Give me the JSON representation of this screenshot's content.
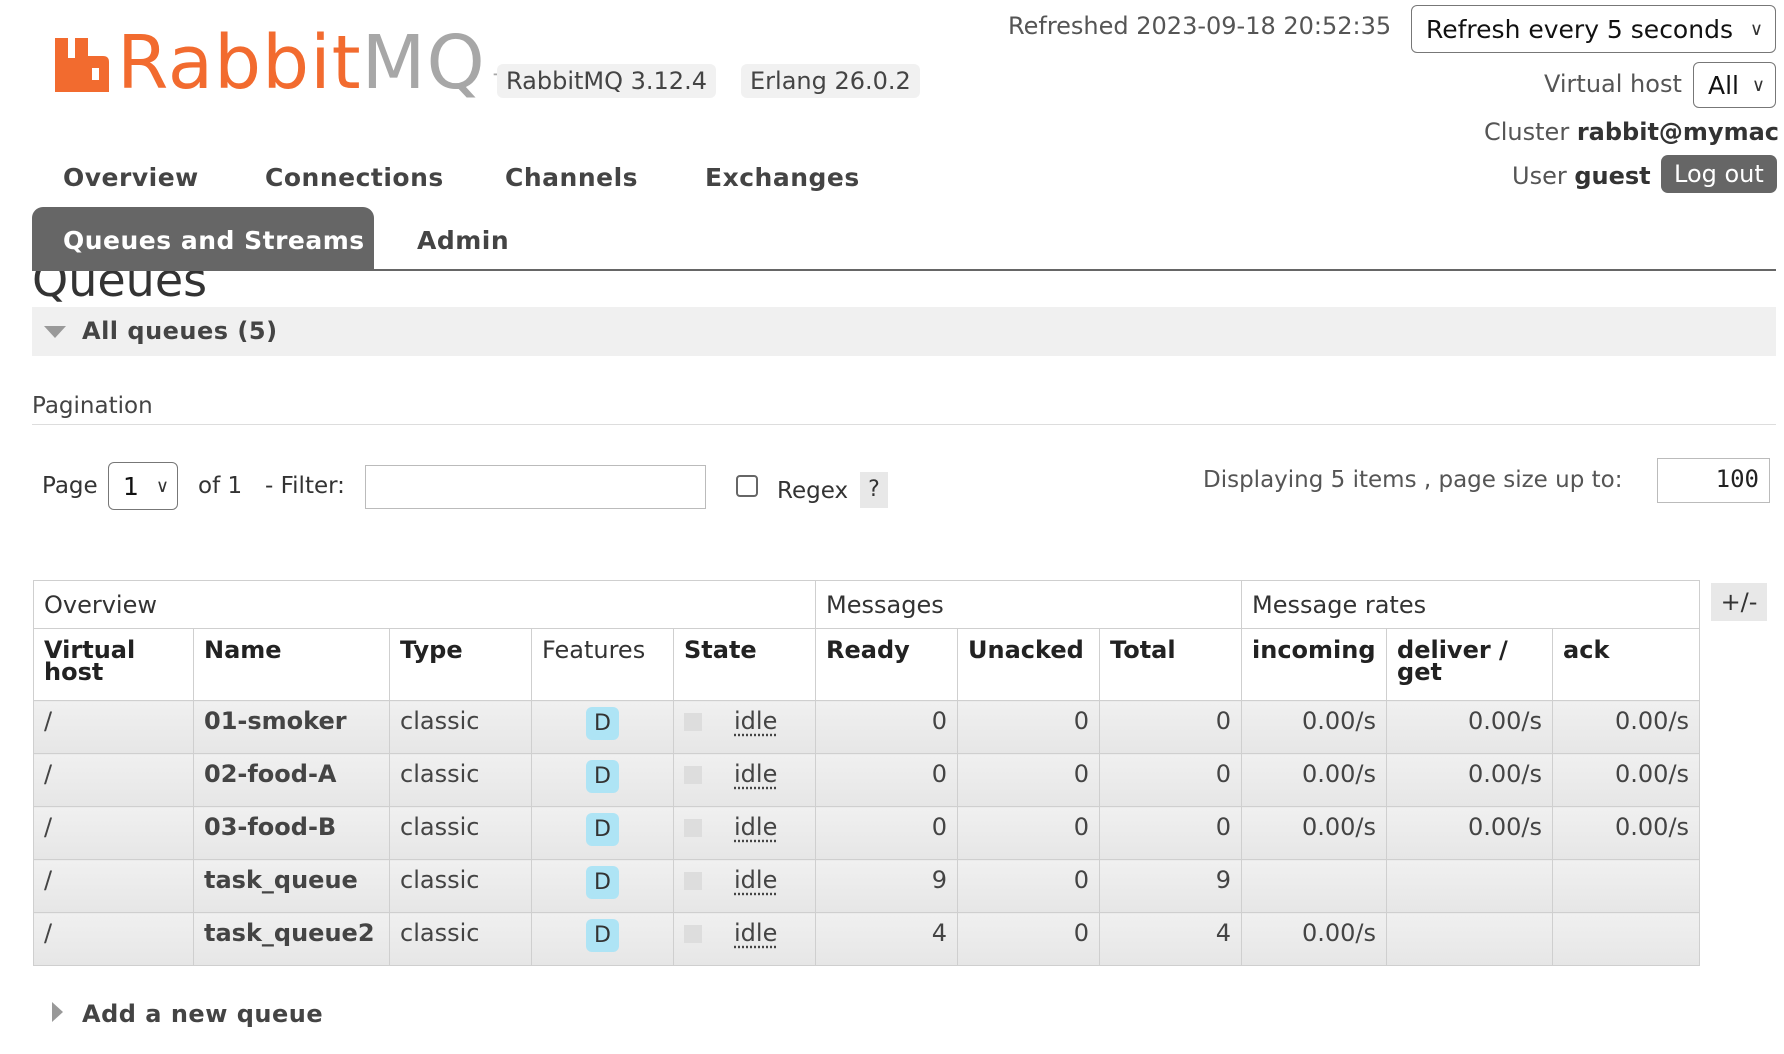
{
  "header": {
    "logo_rabbit": "Rabbit",
    "logo_mq": "MQ",
    "logo_tm": "TM",
    "version_rabbitmq": "RabbitMQ 3.12.4",
    "version_erlang": "Erlang 26.0.2",
    "refreshed_label": "Refreshed 2023-09-18 20:52:35",
    "refresh_select_value": "Refresh every 5 seconds",
    "vhost_label": "Virtual host",
    "vhost_select_value": "All",
    "cluster_label": "Cluster",
    "cluster_value": "rabbit@mymac",
    "user_label": "User",
    "user_value": "guest",
    "logout_label": "Log out"
  },
  "nav": {
    "items": [
      "Overview",
      "Connections",
      "Channels",
      "Exchanges",
      "Queues and Streams",
      "Admin"
    ],
    "active": "Queues and Streams"
  },
  "page": {
    "title": "Queues",
    "section_title": "All queues (5)",
    "pagination_label": "Pagination",
    "page_label": "Page",
    "page_value": "1",
    "of_label": "of 1",
    "filter_label": "- Filter:",
    "filter_value": "",
    "regex_label": "Regex",
    "regex_checked": false,
    "help_label": "?",
    "displaying_label": "Displaying 5 items , page size up to:",
    "page_size_value": "100",
    "add_queue_label": "Add a new queue",
    "plus_minus_label": "+/-"
  },
  "table": {
    "groups": [
      "Overview",
      "Messages",
      "Message rates"
    ],
    "columns": [
      "Virtual host",
      "Name",
      "Type",
      "Features",
      "State",
      "Ready",
      "Unacked",
      "Total",
      "incoming",
      "deliver / get",
      "ack"
    ],
    "rows": [
      {
        "vhost": "/",
        "name": "01-smoker",
        "type": "classic",
        "feature": "D",
        "state": "idle",
        "ready": "0",
        "unacked": "0",
        "total": "0",
        "incoming": "0.00/s",
        "deliver": "0.00/s",
        "ack": "0.00/s"
      },
      {
        "vhost": "/",
        "name": "02-food-A",
        "type": "classic",
        "feature": "D",
        "state": "idle",
        "ready": "0",
        "unacked": "0",
        "total": "0",
        "incoming": "0.00/s",
        "deliver": "0.00/s",
        "ack": "0.00/s"
      },
      {
        "vhost": "/",
        "name": "03-food-B",
        "type": "classic",
        "feature": "D",
        "state": "idle",
        "ready": "0",
        "unacked": "0",
        "total": "0",
        "incoming": "0.00/s",
        "deliver": "0.00/s",
        "ack": "0.00/s"
      },
      {
        "vhost": "/",
        "name": "task_queue",
        "type": "classic",
        "feature": "D",
        "state": "idle",
        "ready": "9",
        "unacked": "0",
        "total": "9",
        "incoming": "",
        "deliver": "",
        "ack": ""
      },
      {
        "vhost": "/",
        "name": "task_queue2",
        "type": "classic",
        "feature": "D",
        "state": "idle",
        "ready": "4",
        "unacked": "0",
        "total": "4",
        "incoming": "0.00/s",
        "deliver": "",
        "ack": ""
      }
    ]
  },
  "colors": {
    "brand_orange": "#f26b2f",
    "nav_active_bg": "#666666",
    "feature_badge_bg": "#aee4f5"
  }
}
